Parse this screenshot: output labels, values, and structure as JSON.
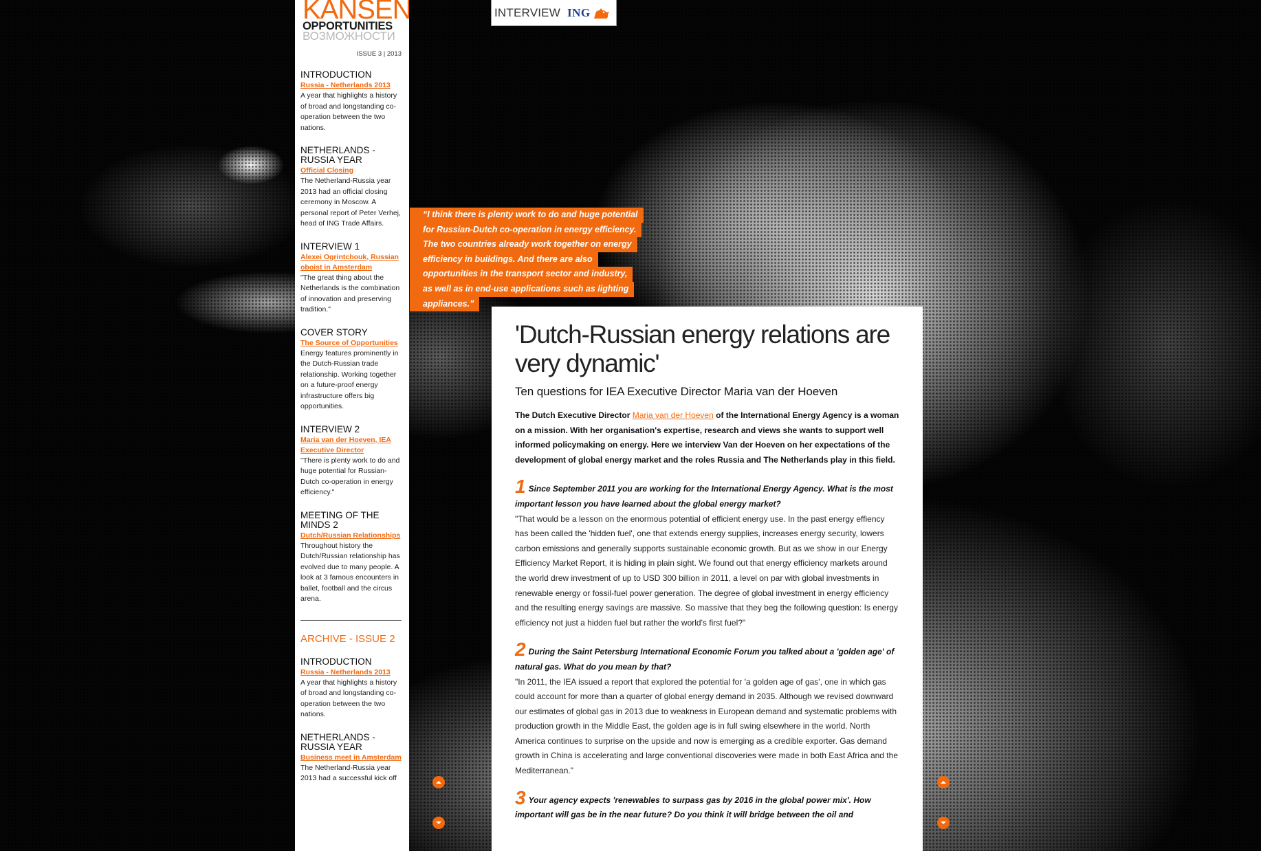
{
  "brand": {
    "title": "KANSEN",
    "subtitle_en": "OPPORTUNITIES",
    "subtitle_ru": "ВОЗМОЖНОСТИ",
    "issue": "ISSUE 3 | 2013"
  },
  "topbar": {
    "label": "INTERVIEW",
    "logo": "ING"
  },
  "sidebar": {
    "sections": [
      {
        "heading": "INTRODUCTION",
        "link": "Russia - Netherlands 2013",
        "text": "A year that highlights a history of broad and longstanding co-operation between the two nations."
      },
      {
        "heading": "NETHERLANDS - RUSSIA YEAR",
        "link": "Official Closing",
        "text": "The Netherland-Russia year 2013 had an official closing ceremony in Moscow. A personal report of Peter Verhej, head of ING Trade Affairs."
      },
      {
        "heading": "INTERVIEW 1",
        "link": "Alexei Ogrintchouk, Russian oboist in Amsterdam",
        "text": "\"The great thing about the Netherlands is the combination of innovation and preserving tradition.\""
      },
      {
        "heading": "COVER STORY",
        "link": "The Source of Opportunities",
        "text": "Energy features prominently in the Dutch-Russian trade relationship. Working together on a future-proof energy infrastructure offers big opportunities."
      },
      {
        "heading": "INTERVIEW 2",
        "link": "Maria van der Hoeven, IEA Executive Director",
        "text": "\"There is plenty work to do and huge potential for Russian-Dutch co-operation in energy efficiency.\""
      },
      {
        "heading": "MEETING OF THE MINDS 2",
        "link": "Dutch/Russian Relationships",
        "text": "Throughout history the Dutch/Russian relationship has evolved due to many people. A look at 3 famous encounters in ballet, football and the circus arena."
      }
    ],
    "archive_title": "ARCHIVE - ISSUE 2",
    "archive_sections": [
      {
        "heading": "INTRODUCTION",
        "link": "Russia - Netherlands 2013",
        "text": "A year that highlights a history of broad and longstanding co-operation between the two nations."
      },
      {
        "heading": "NETHERLANDS - RUSSIA YEAR",
        "link": "Business meet in Amsterdam",
        "text": "The Netherland-Russia year 2013 had a successful kick off"
      }
    ]
  },
  "quote": {
    "lines": [
      "“I think there is plenty work to do and huge potential",
      "for Russian-Dutch co-operation in energy efficiency.",
      "The two countries already work together on energy",
      "efficiency in buildings. And there are also",
      "opportunities in the transport sector and industry,",
      "as well as in end-use applications such as lighting",
      "appliances.”"
    ]
  },
  "article": {
    "title": "'Dutch-Russian energy relations are very dynamic'",
    "subtitle": "Ten questions for IEA Executive Director Maria van der Hoeven",
    "lead_before": "The Dutch Executive Director ",
    "lead_link": "Maria van der Hoeven",
    "lead_after": " of the International Energy Agency is a woman on a mission. With her organisation's expertise, research and views she wants to support well informed policymaking on energy. Here we interview Van der Hoeven on her expectations of the development of global energy market and the roles Russia and The Netherlands play in this field.",
    "qa": [
      {
        "num": "1",
        "question": "Since September 2011 you are working for the International Energy Agency. What is the most important lesson you have learned about the global energy market?",
        "answer": "\"That would be a lesson on the enormous potential of efficient energy use. In the past energy effiency has been called the 'hidden fuel', one that extends energy supplies, increases energy security, lowers carbon emissions and generally supports sustainable economic growth. But as we show in our Energy Efficiency Market Report, it is hiding in plain sight. We found out that energy efficiency markets around the world drew investment of up to USD 300 billion in 2011, a level on par with global investments in renewable energy or fossil-fuel power generation. The degree of global investment in energy efficiency and the resulting energy savings are massive. So massive that they beg the following question: Is energy efficiency not just a hidden fuel but rather the world's first fuel?\""
      },
      {
        "num": "2",
        "question": "During the Saint Petersburg International Economic Forum you talked about a 'golden age' of natural gas. What do you mean by that?",
        "answer": "\"In 2011, the IEA issued a report that explored the potential for 'a golden age of gas', one in which gas could account for more than a quarter of global energy demand in 2035. Although we revised downward our estimates of global gas in 2013 due to weakness in European demand and systematic problems with production growth in the Middle East, the golden age is in full swing elsewhere in the world. North America continues to surprise on the upside and now is emerging as a credible exporter. Gas demand growth in China is accelerating and large conventional discoveries were made in both East Africa and the Mediterranean.\""
      },
      {
        "num": "3",
        "question": "Your agency expects 'renewables to surpass gas by 2016 in the global power mix'. How important will gas be in the near future? Do you think it will bridge between the oil and",
        "answer": ""
      }
    ]
  },
  "colors": {
    "accent": "#f26a10",
    "ing_blue": "#1d3f8c"
  }
}
